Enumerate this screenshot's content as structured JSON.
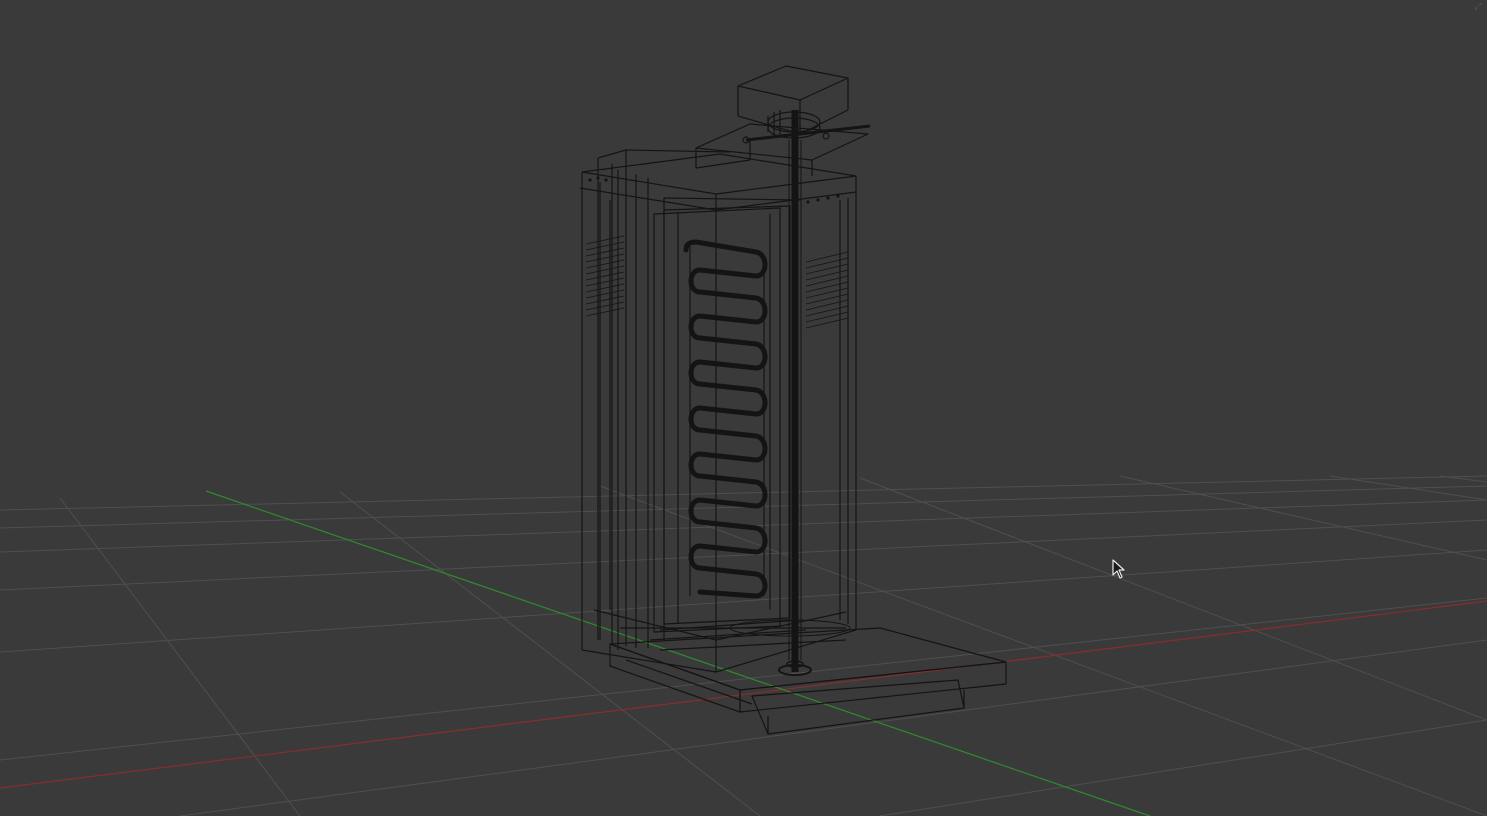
{
  "viewport": {
    "background": "#3a3a3a",
    "grid_color": "#4f4f4f",
    "axis_x_color": "#8a2c2c",
    "axis_z_color": "#2f8a2f",
    "wire_color": "#141414",
    "corner_glyph": "⤢"
  },
  "scene": {
    "object": "vertical-broiler-wireframe",
    "shading": "wireframe",
    "grid": true
  },
  "cursor": {
    "type": "arrow-pointer"
  }
}
